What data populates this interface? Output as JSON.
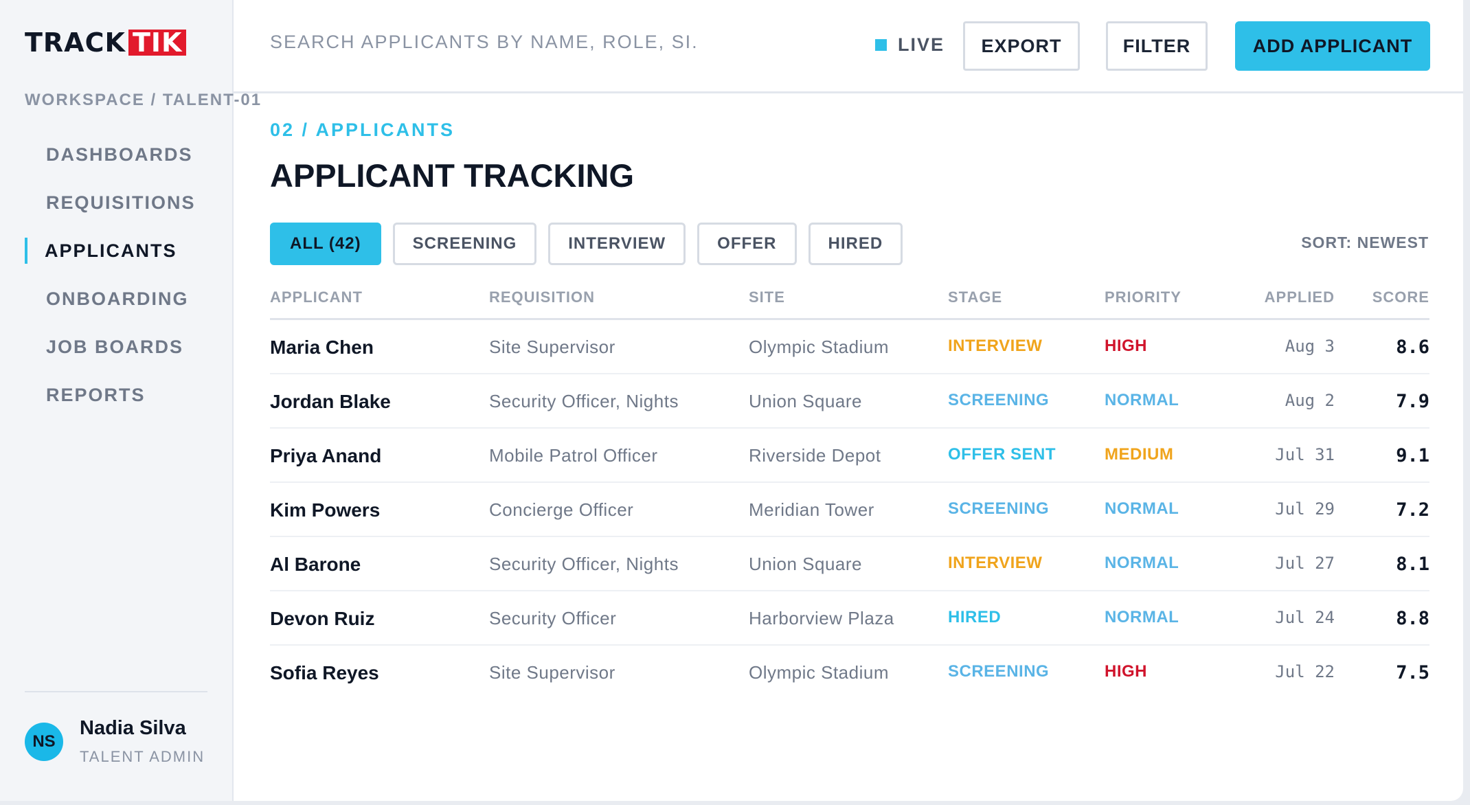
{
  "brand": {
    "part1": "TRACK",
    "part2": "TIK"
  },
  "sidebar": {
    "workspace": "WORKSPACE / TALENT-01",
    "items": [
      {
        "label": "DASHBOARDS"
      },
      {
        "label": "REQUISITIONS"
      },
      {
        "label": "APPLICANTS",
        "active": true
      },
      {
        "label": "ONBOARDING"
      },
      {
        "label": "JOB BOARDS"
      },
      {
        "label": "REPORTS"
      }
    ],
    "user": {
      "initials": "NS",
      "name": "Nadia Silva",
      "role": "TALENT ADMIN"
    }
  },
  "topbar": {
    "search_placeholder": "SEARCH APPLICANTS BY NAME, ROLE, SI...",
    "live_label": "LIVE",
    "export_label": "EXPORT",
    "filter_label": "FILTER",
    "add_label": "ADD APPLICANT"
  },
  "main": {
    "eyebrow": "02 / APPLICANTS",
    "title": "APPLICANT TRACKING",
    "filters": [
      "ALL (42)",
      "SCREENING",
      "INTERVIEW",
      "OFFER",
      "HIRED"
    ],
    "active_filter": 0,
    "sort_label": "SORT: NEWEST"
  },
  "table": {
    "headers": {
      "applicant": "APPLICANT",
      "requisition": "REQUISITION",
      "site": "SITE",
      "stage": "STAGE",
      "priority": "PRIORITY",
      "applied": "APPLIED",
      "score": "SCORE"
    },
    "rows": [
      {
        "name": "Maria Chen",
        "requisition": "Site Supervisor",
        "site": "Olympic Stadium",
        "stage": "INTERVIEW",
        "priority": "HIGH",
        "applied": "Aug 3",
        "score": "8.6"
      },
      {
        "name": "Jordan Blake",
        "requisition": "Security Officer, Nights",
        "site": "Union Square",
        "stage": "SCREENING",
        "priority": "NORMAL",
        "applied": "Aug 2",
        "score": "7.9"
      },
      {
        "name": "Priya Anand",
        "requisition": "Mobile Patrol Officer",
        "site": "Riverside Depot",
        "stage": "OFFER SENT",
        "priority": "MEDIUM",
        "applied": "Jul 31",
        "score": "9.1"
      },
      {
        "name": "Kim Powers",
        "requisition": "Concierge Officer",
        "site": "Meridian Tower",
        "stage": "SCREENING",
        "priority": "NORMAL",
        "applied": "Jul 29",
        "score": "7.2"
      },
      {
        "name": "Al Barone",
        "requisition": "Security Officer, Nights",
        "site": "Union Square",
        "stage": "INTERVIEW",
        "priority": "NORMAL",
        "applied": "Jul 27",
        "score": "8.1"
      },
      {
        "name": "Devon Ruiz",
        "requisition": "Security Officer",
        "site": "Harborview Plaza",
        "stage": "HIRED",
        "priority": "NORMAL",
        "applied": "Jul 24",
        "score": "8.8"
      },
      {
        "name": "Sofia Reyes",
        "requisition": "Site Supervisor",
        "site": "Olympic Stadium",
        "stage": "SCREENING",
        "priority": "HIGH",
        "applied": "Jul 22",
        "score": "7.5"
      }
    ]
  },
  "colors": {
    "accent": "#2ebfe8",
    "brand_red": "#e21a2c",
    "stage": {
      "INTERVIEW": "#f0a41c",
      "SCREENING": "#5ab4e6",
      "OFFER SENT": "#2ebfe8",
      "HIRED": "#2ebfe8"
    },
    "priority": {
      "HIGH": "#d0142c",
      "NORMAL": "#5ab4e6",
      "MEDIUM": "#f0a41c"
    }
  }
}
